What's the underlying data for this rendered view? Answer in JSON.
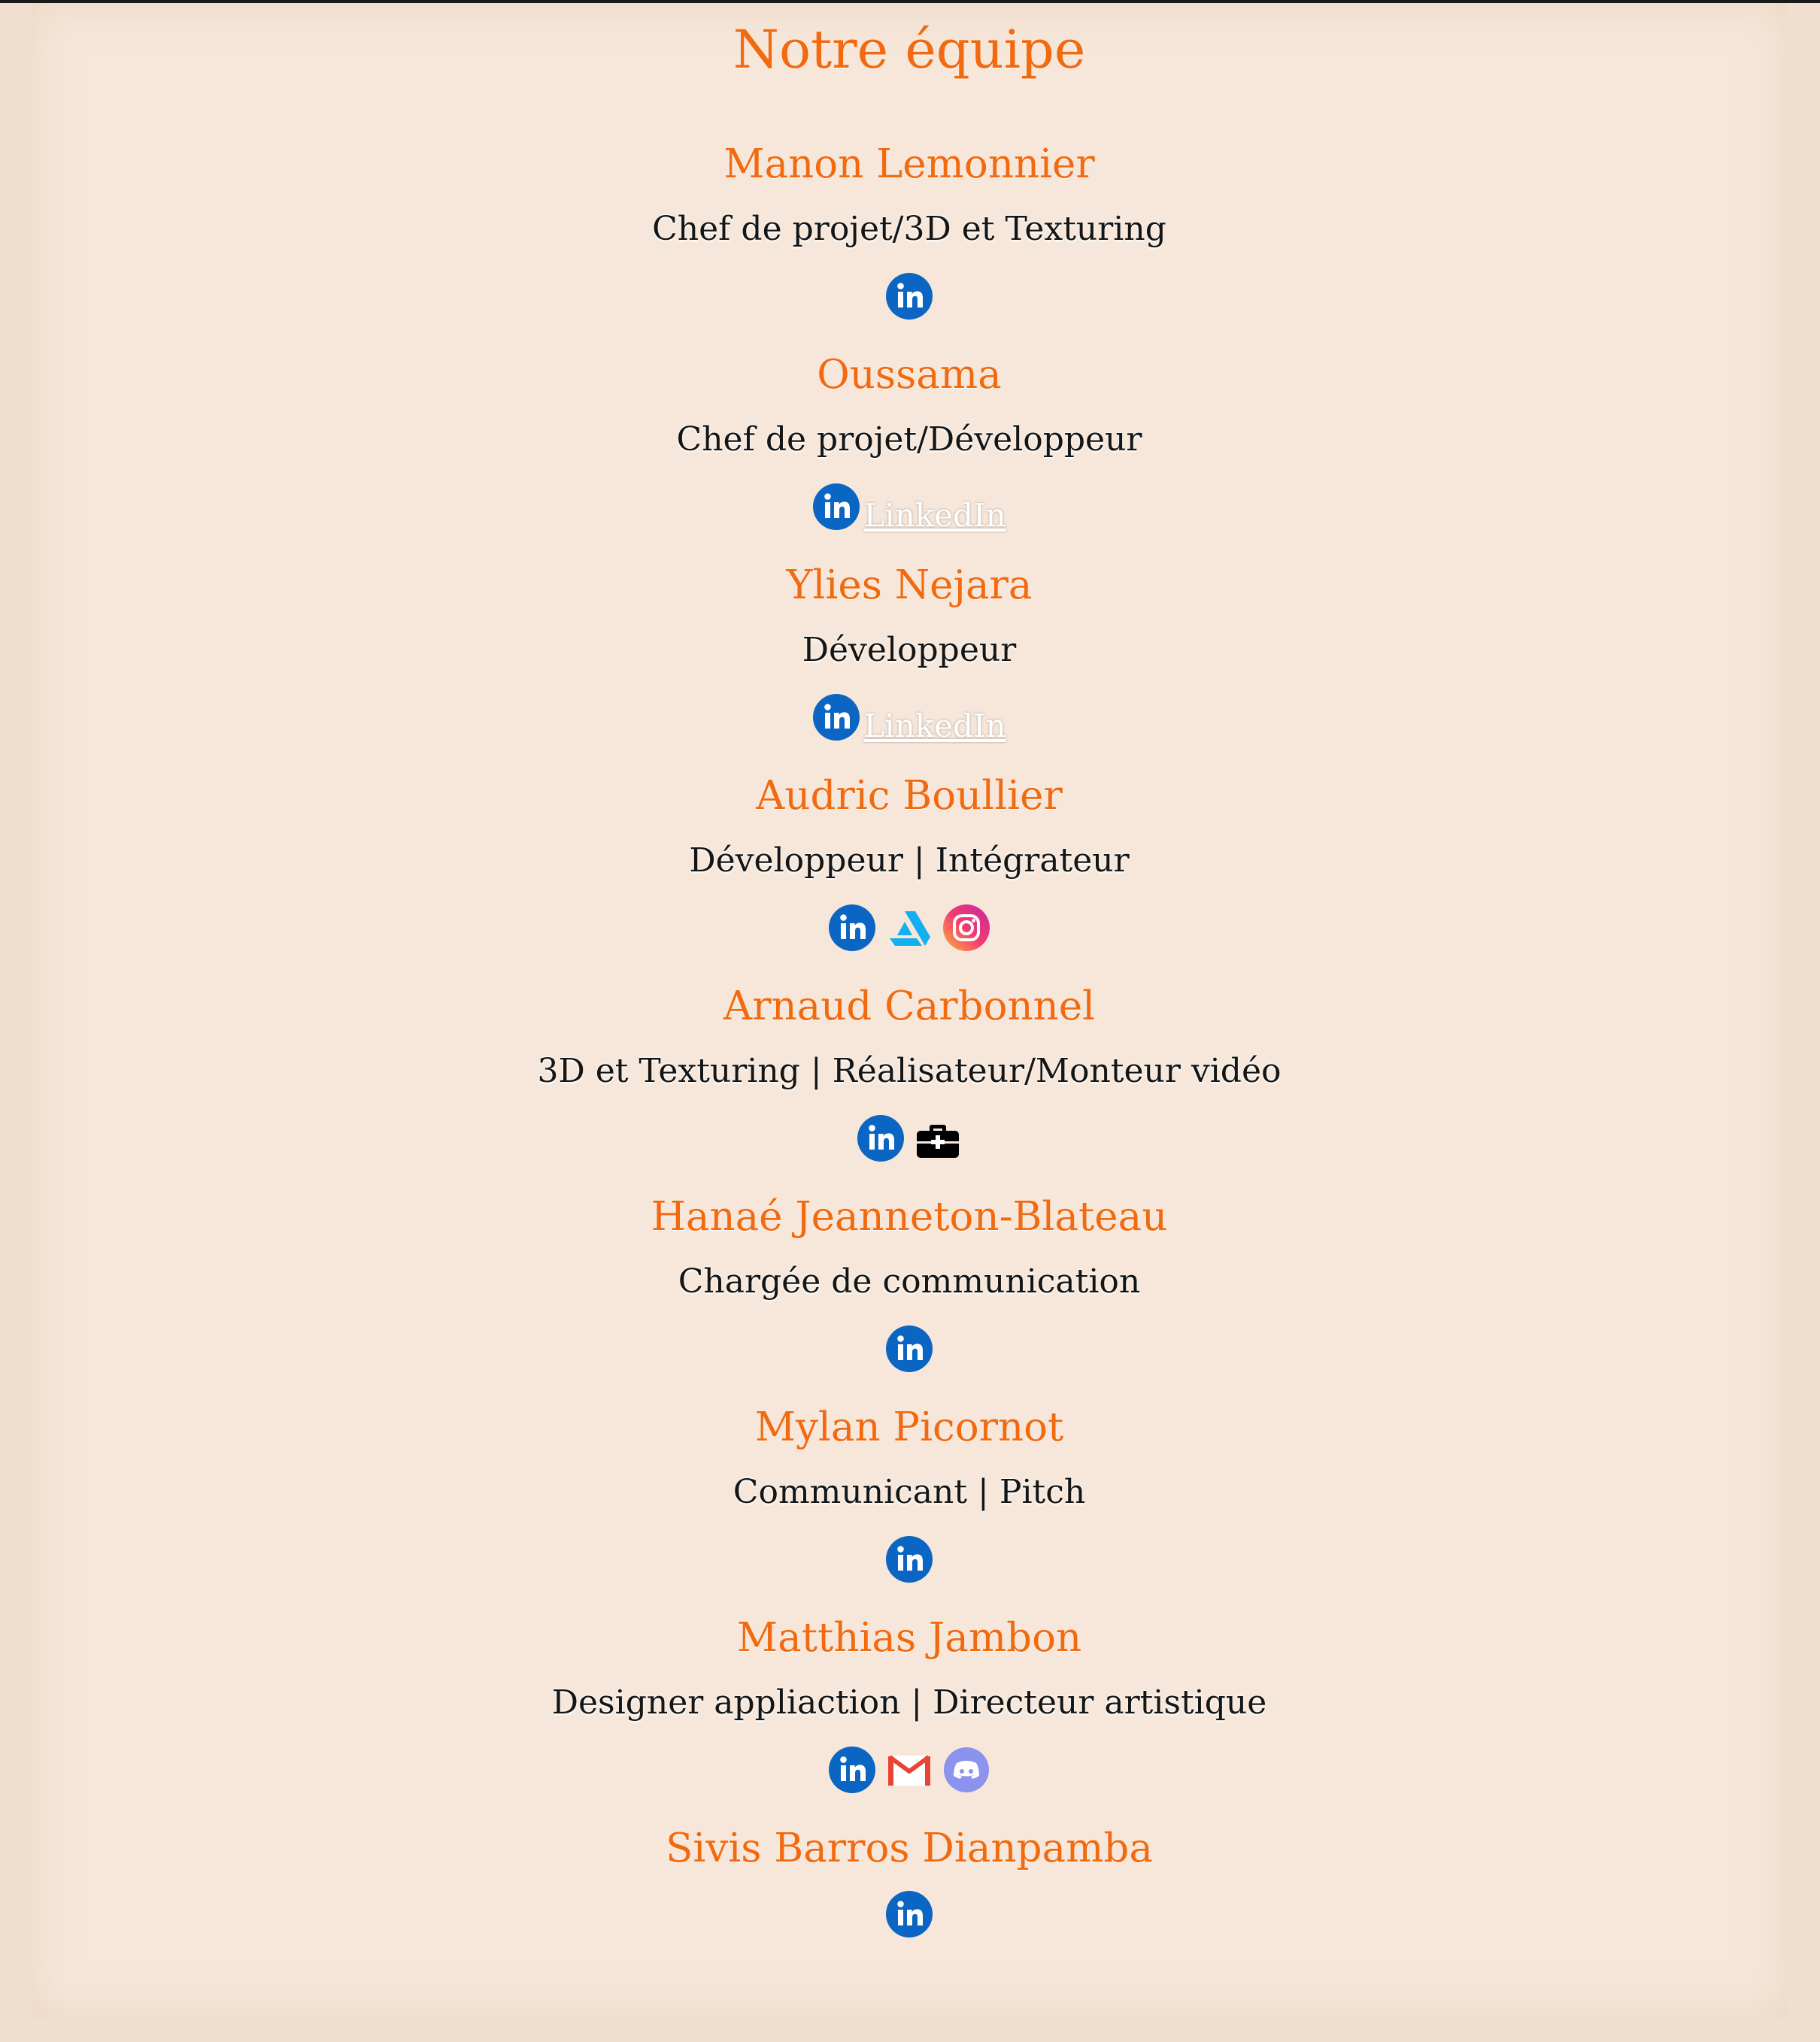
{
  "page": {
    "title": "Notre équipe"
  },
  "colors": {
    "accent": "#f26a10",
    "background": "#f6e7da",
    "linkedin": "#0a66c2"
  },
  "members": [
    {
      "name": "Manon Lemonnier",
      "role": "Chef de projet/3D et Texturing",
      "links": [
        {
          "icon": "linkedin-icon"
        }
      ]
    },
    {
      "name": "Oussama",
      "role": "Chef de projet/Développeur",
      "links": [
        {
          "icon": "linkedin-icon",
          "label": " LinkedIn"
        }
      ]
    },
    {
      "name": "Ylies Nejara",
      "role": "Développeur",
      "links": [
        {
          "icon": "linkedin-icon",
          "label": " LinkedIn"
        }
      ]
    },
    {
      "name": "Audric Boullier",
      "role": "Développeur | Intégrateur",
      "links": [
        {
          "icon": "linkedin-icon"
        },
        {
          "icon": "artstation-icon"
        },
        {
          "icon": "instagram-icon"
        }
      ]
    },
    {
      "name": "Arnaud Carbonnel",
      "role": "3D et Texturing | Réalisateur/Monteur vidéo",
      "links": [
        {
          "icon": "linkedin-icon"
        },
        {
          "icon": "portfolio-briefcase-icon"
        }
      ]
    },
    {
      "name": "Hanaé Jeanneton-Blateau",
      "role": "Chargée de communication",
      "links": [
        {
          "icon": "linkedin-icon"
        }
      ]
    },
    {
      "name": "Mylan Picornot",
      "role": "Communicant | Pitch",
      "links": [
        {
          "icon": "linkedin-icon"
        }
      ]
    },
    {
      "name": "Matthias Jambon",
      "role": "Designer appliaction | Directeur artistique",
      "links": [
        {
          "icon": "linkedin-icon"
        },
        {
          "icon": "gmail-icon"
        },
        {
          "icon": "discord-icon"
        }
      ]
    },
    {
      "name": "Sivis Barros Dianpamba",
      "role": "",
      "links": [
        {
          "icon": "linkedin-icon"
        }
      ]
    }
  ]
}
